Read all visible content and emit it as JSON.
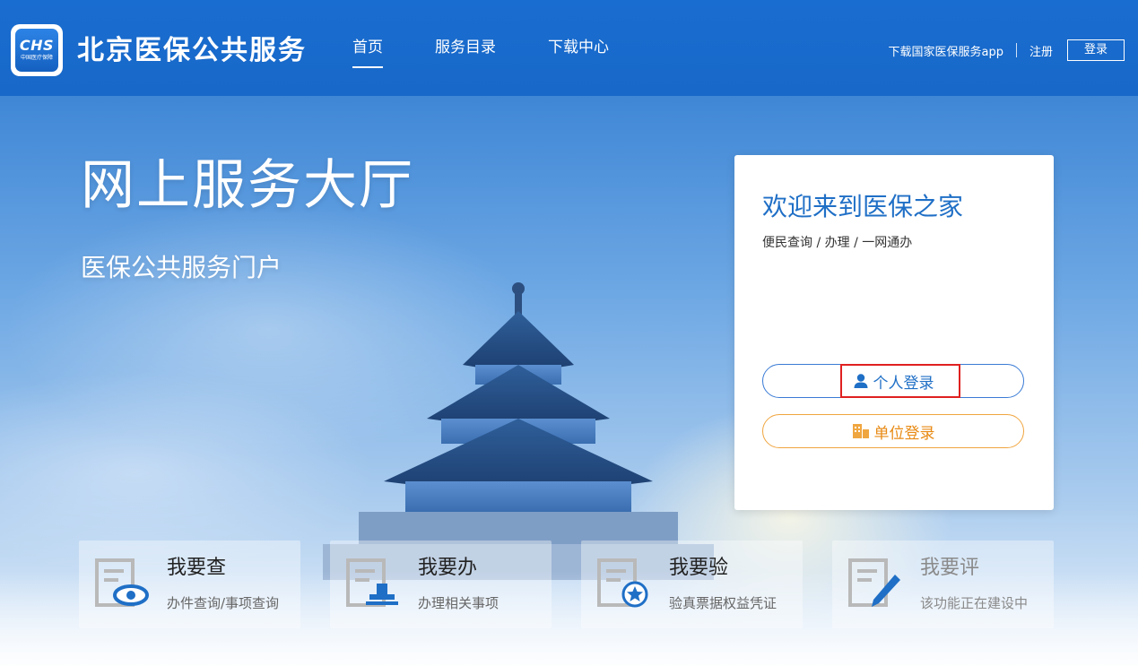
{
  "header": {
    "logo_text": "CHS",
    "logo_sub": "中国医疗保障",
    "site_title": "北京医保公共服务",
    "nav": [
      {
        "label": "首页",
        "active": true
      },
      {
        "label": "服务目录",
        "active": false
      },
      {
        "label": "下载中心",
        "active": false
      }
    ],
    "download_app": "下载国家医保服务app",
    "register": "注册",
    "login": "登录"
  },
  "hero": {
    "title": "网上服务大厅",
    "subtitle": "医保公共服务门户"
  },
  "login_card": {
    "title": "欢迎来到医保之家",
    "subtitle": "便民查询 / 办理 / 一网通办",
    "personal_login": "个人登录",
    "unit_login": "单位登录"
  },
  "tiles": [
    {
      "title": "我要查",
      "desc": "办件查询/事项查询",
      "icon": "eye-icon"
    },
    {
      "title": "我要办",
      "desc": "办理相关事项",
      "icon": "stamp-icon"
    },
    {
      "title": "我要验",
      "desc": "验真票据权益凭证",
      "icon": "star-badge-icon"
    },
    {
      "title": "我要评",
      "desc": "该功能正在建设中",
      "icon": "pen-icon"
    }
  ],
  "colors": {
    "header_bg": "#1a6dd0",
    "primary": "#1f6fc6",
    "unit_accent": "#e88a14",
    "highlight": "#e02020"
  }
}
